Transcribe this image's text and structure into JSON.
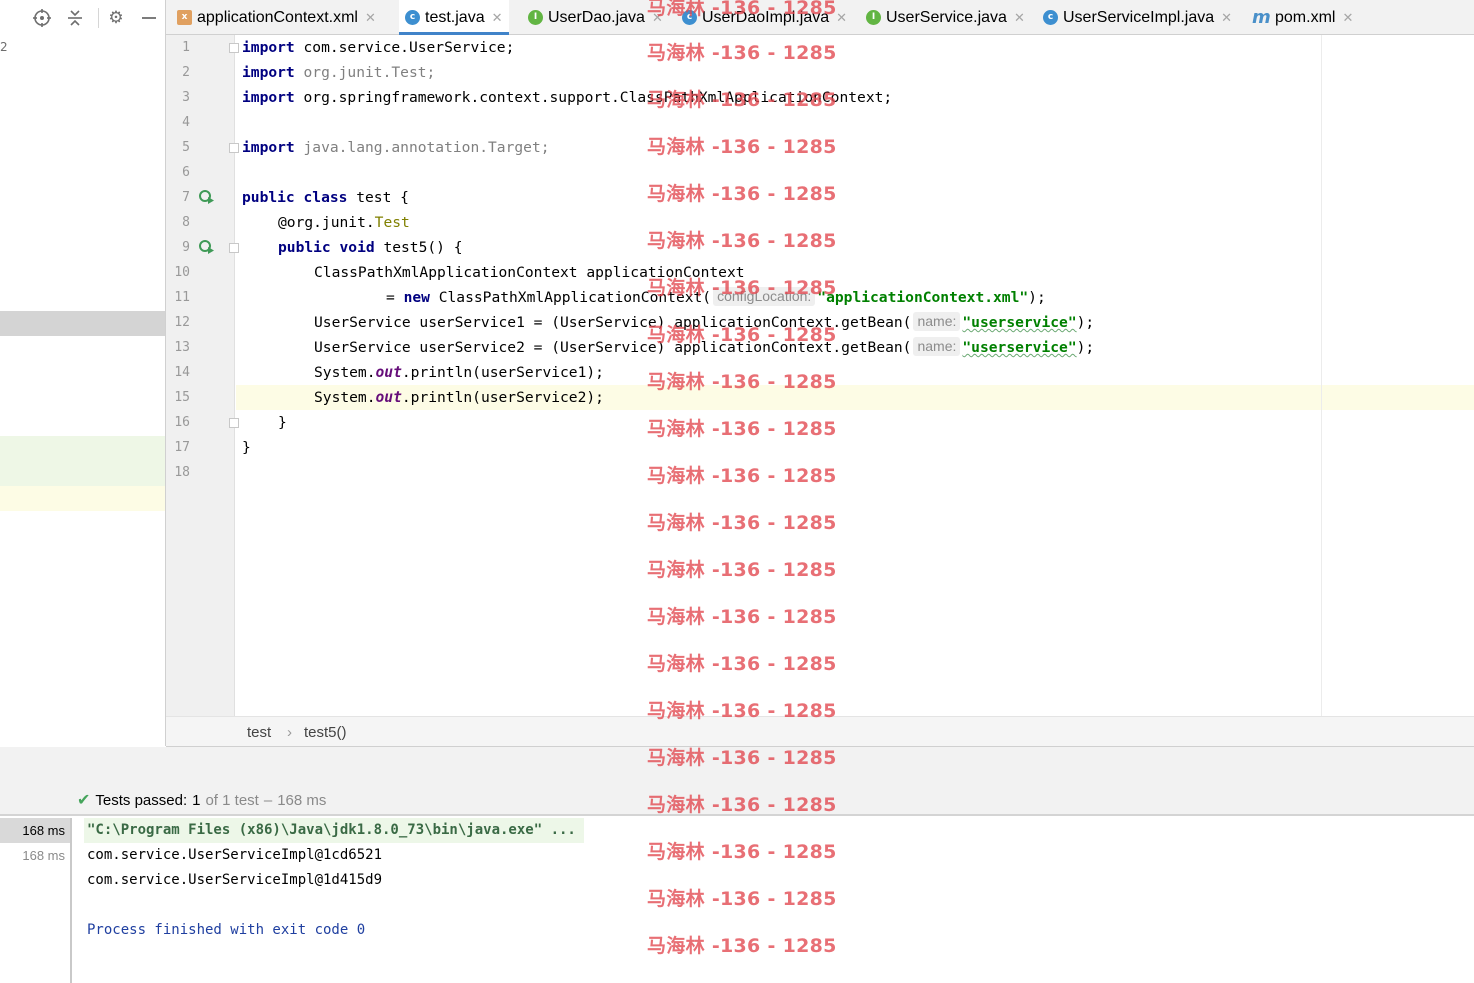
{
  "left_panel": {
    "edge_text": "2",
    "toolbar": [
      "locate-icon",
      "collapse-icon",
      "gear-icon",
      "hide-icon"
    ],
    "row_colors": {
      "selected": "#d4d4d4",
      "added": "#eef7e6",
      "modified": "#fdfce5"
    }
  },
  "tabs": [
    {
      "label": "applicationContext.xml",
      "icon": "xml",
      "icon_text": "x",
      "active": false
    },
    {
      "label": "test.java",
      "icon": "class",
      "icon_text": "c",
      "active": true
    },
    {
      "label": "UserDao.java",
      "icon": "interface",
      "icon_text": "I",
      "active": false
    },
    {
      "label": "UserDaoImpl.java",
      "icon": "class",
      "icon_text": "c",
      "active": false
    },
    {
      "label": "UserService.java",
      "icon": "interface",
      "icon_text": "I",
      "active": false
    },
    {
      "label": "UserServiceImpl.java",
      "icon": "class",
      "icon_text": "c",
      "active": false
    },
    {
      "label": "pom.xml",
      "icon": "maven",
      "icon_text": "m",
      "active": false
    }
  ],
  "tab_close_glyph": "✕",
  "editor": {
    "line_numbers": [
      "1",
      "2",
      "3",
      "4",
      "5",
      "6",
      "7",
      "8",
      "9",
      "10",
      "11",
      "12",
      "13",
      "14",
      "15",
      "16",
      "17",
      "18"
    ],
    "current_line": 15,
    "code": {
      "l1_kw": "import",
      "l1_rest": " com.service.UserService;",
      "l2_kw": "import",
      "l2_rest": " org.junit.Test;",
      "l3_kw": "import",
      "l3_rest": " org.springframework.context.support.ClassPathXmlApplicationContext;",
      "l5_kw": "import",
      "l5_rest": " java.lang.annotation.Target;",
      "l7_kw": "public class",
      "l7_rest": " test {",
      "l8_ann": "@org.junit.",
      "l8_type": "Test",
      "l9_kw": "public void",
      "l9_rest": " test5() {",
      "l10": "ClassPathXmlApplicationContext applicationContext",
      "l11_eq": "= ",
      "l11_kw": "new",
      "l11_rest": " ClassPathXmlApplicationContext(",
      "l11_hint": "configLocation:",
      "l11_str": "\"applicationContext.xml\"",
      "l11_end": ");",
      "l12_pre": "UserService userService1 = (UserService) applicationContext.getBean(",
      "l12_hint": "name:",
      "l12_str": "\"userservice\"",
      "l12_end": ");",
      "l13_pre": "UserService userService2 = (UserService) applicationContext.getBean(",
      "l13_hint": "name:",
      "l13_str": "\"userservice\"",
      "l13_end": ");",
      "l14_a": "System.",
      "l14_out": "out",
      "l14_b": ".println(userService1);",
      "l15_a": "System.",
      "l15_out": "out",
      "l15_b": ".println(userService2);",
      "l16": "}",
      "l17": "}"
    }
  },
  "breadcrumb": {
    "class": "test",
    "sep": "›",
    "method": "test5()"
  },
  "run": {
    "status_label": "Tests passed:",
    "passed": "1",
    "of_total": "of 1 test",
    "dash": "–",
    "duration": "168 ms",
    "times": [
      "168 ms",
      "168 ms"
    ],
    "console": [
      "\"C:\\Program Files (x86)\\Java\\jdk1.8.0_73\\bin\\java.exe\" ...",
      "com.service.UserServiceImpl@1cd6521",
      "com.service.UserServiceImpl@1d415d9",
      "",
      "Process finished with exit code 0"
    ]
  },
  "watermark": "马海林 -136 - 1285",
  "colors": {
    "accent": "#4083c9",
    "keyword": "#000080",
    "string": "#008000",
    "annotation": "#808000",
    "static_field": "#660e7a",
    "watermark": "#e2464e",
    "pass": "#45a45b"
  }
}
